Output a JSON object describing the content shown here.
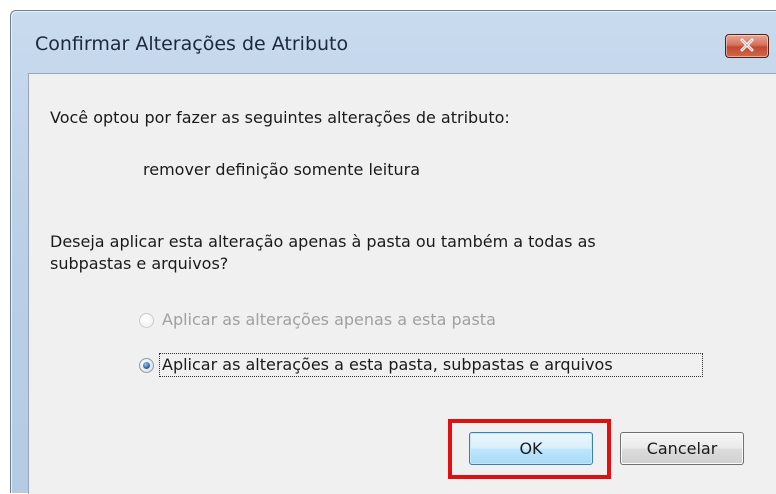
{
  "dialog": {
    "title": "Confirmar Alterações de Atributo",
    "close_icon": "close-icon",
    "message": "Você optou por fazer as seguintes alterações de atributo:",
    "change_item": "remover definição somente leitura",
    "question_line1": "Deseja aplicar esta alteração apenas à pasta ou também a todas as",
    "question_line2": "subpastas e arquivos?",
    "options": [
      {
        "label": "Aplicar as alterações apenas a esta pasta",
        "selected": false,
        "enabled": false
      },
      {
        "label": "Aplicar as alterações a esta pasta, subpastas e arquivos",
        "selected": true,
        "enabled": true
      }
    ],
    "buttons": {
      "ok": "OK",
      "cancel": "Cancelar"
    }
  },
  "colors": {
    "highlight": "#e01010",
    "close_button": "#c04a30",
    "default_button_border": "#3c7fb1"
  }
}
